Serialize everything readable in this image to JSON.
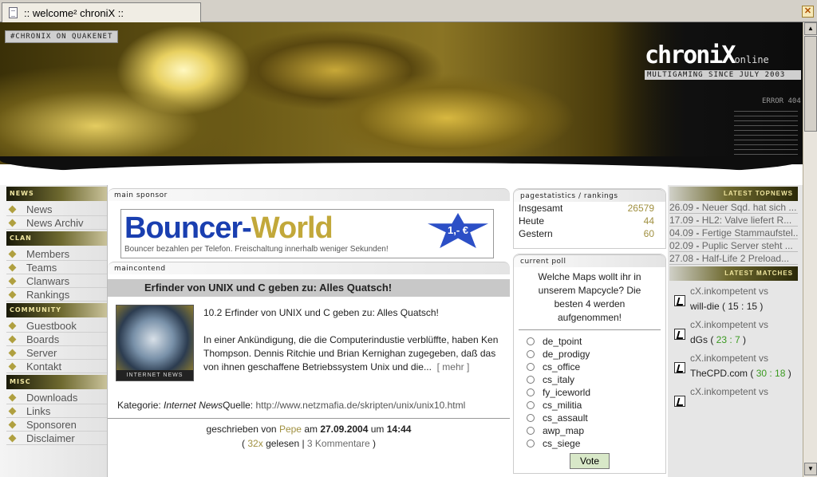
{
  "tab": {
    "title": ":: welcome² chroniX ::",
    "close": "✕"
  },
  "banner": {
    "irc": "#CHRONIX ON QUAKENET",
    "logo": "chroniX",
    "logo_sub": "online",
    "tagline": "MULTIGAMING SINCE JULY 2003",
    "error": "ERROR 404"
  },
  "sidebar": [
    {
      "head": "NEWS",
      "items": [
        "News",
        "News Archiv"
      ]
    },
    {
      "head": "CLAN",
      "items": [
        "Members",
        "Teams",
        "Clanwars",
        "Rankings"
      ]
    },
    {
      "head": "COMMUNITY",
      "items": [
        "Guestbook",
        "Boards",
        "Server",
        "Kontakt"
      ]
    },
    {
      "head": "MISC",
      "items": [
        "Downloads",
        "Links",
        "Sponsoren",
        "Disclaimer"
      ]
    }
  ],
  "sponsor": {
    "head": "main sponsor",
    "brand_a": "Bouncer-",
    "brand_b": "World",
    "slogan": "Bouncer bezahlen per Telefon. Freischaltung innerhalb weniger Sekunden!",
    "price": "1,- €"
  },
  "maincontent": {
    "head": "maincontend",
    "title": "Erfinder von UNIX und C geben zu: Alles Quatsch!",
    "img_label": "INTERNET NEWS",
    "p1": "10.2 Erfinder von UNIX und C geben zu: Alles Quatsch!",
    "p2": "In einer Ankündigung, die die Computerindustie verblüffte, haben Ken Thompson. Dennis Ritchie und Brian Kernighan zugegeben, daß das von ihnen geschaffene Betriebssystem Unix und die...",
    "more": "[ mehr ]",
    "kat_label": "Kategorie:",
    "kat_value": "Internet News",
    "src_label": "Quelle:",
    "src_url": "http://www.netzmafia.de/skripten/unix/unix10.html",
    "written_by": "geschrieben von",
    "author": "Pepe",
    "am": "am",
    "date": "27.09.2004",
    "um": "um",
    "time": "14:44",
    "reads": "32x",
    "read_label": "gelesen",
    "comments": "3 Kommentare"
  },
  "stats": {
    "head": "pagestatistics / rankings",
    "rows": [
      {
        "label": "Insgesamt",
        "value": "26579"
      },
      {
        "label": "Heute",
        "value": "44"
      },
      {
        "label": "Gestern",
        "value": "60"
      }
    ]
  },
  "poll": {
    "head": "current poll",
    "question": "Welche Maps wollt ihr in unserem Mapcycle? Die besten 4 werden aufgenommen!",
    "options": [
      "de_tpoint",
      "de_prodigy",
      "cs_office",
      "cs_italy",
      "fy_iceworld",
      "cs_militia",
      "cs_assault",
      "awp_map",
      "cs_siege"
    ],
    "vote": "Vote"
  },
  "topnews": {
    "head": "LATEST TOPNEWS",
    "items": [
      {
        "date": "26.09",
        "title": "Neuer Sqd. hat sich ..."
      },
      {
        "date": "17.09",
        "title": "HL2: Valve liefert R..."
      },
      {
        "date": "04.09",
        "title": "Fertige Stammaufstel..."
      },
      {
        "date": "02.09",
        "title": "Puplic Server steht ..."
      },
      {
        "date": "27.08",
        "title": "Half-Life 2 Preload..."
      }
    ]
  },
  "matches": {
    "head": "LATEST MATCHES",
    "items": [
      {
        "l1": "cX.inkompetent vs",
        "opp": "will-die",
        "score": "15 : 15",
        "color": "#222"
      },
      {
        "l1": "cX.inkompetent vs",
        "opp": "dGs",
        "score": "23 : 7",
        "color": "#3a9a20"
      },
      {
        "l1": "cX.inkompetent vs",
        "opp": "TheCPD.com",
        "score": "30 : 18",
        "color": "#3a9a20"
      },
      {
        "l1": "cX.inkompetent vs",
        "opp": "",
        "score": "",
        "color": "#222"
      }
    ]
  }
}
